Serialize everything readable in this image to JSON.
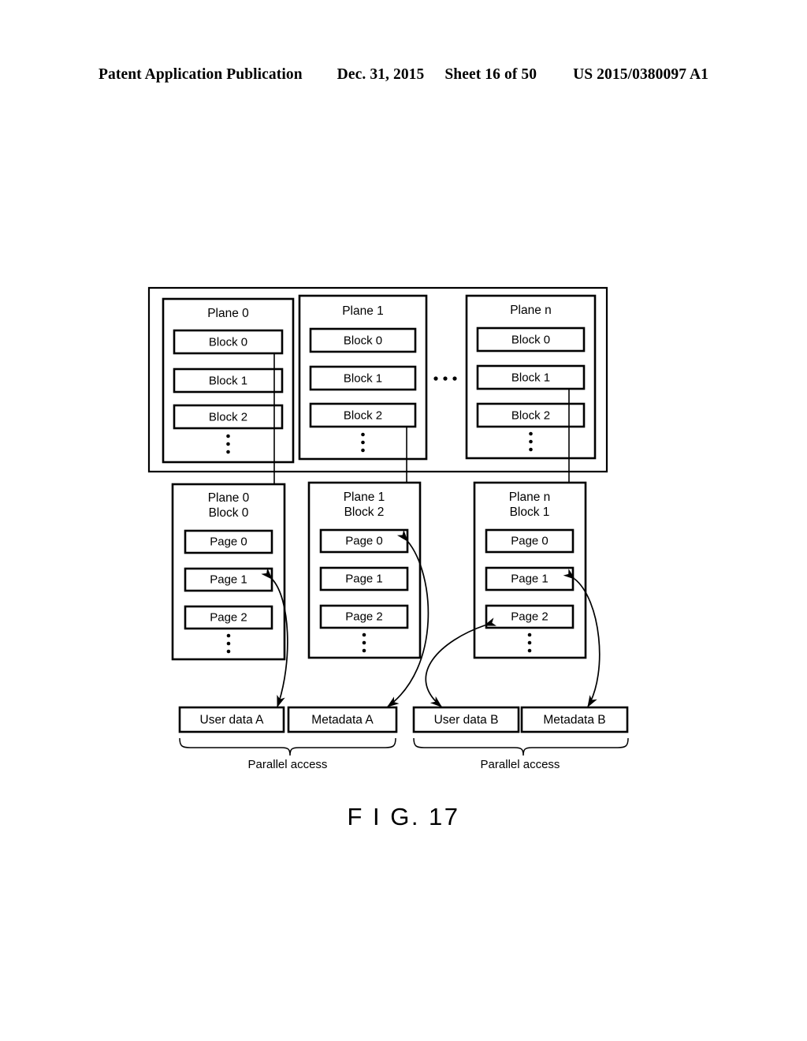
{
  "header": {
    "publication": "Patent Application Publication",
    "date": "Dec. 31, 2015",
    "sheet": "Sheet 16 of 50",
    "patent_number": "US 2015/0380097 A1"
  },
  "figure": {
    "caption": "F I G. 17",
    "ellipsis_horizontal": "• • •",
    "top_section": {
      "planes": [
        {
          "title": "Plane 0",
          "blocks": [
            "Block 0",
            "Block 1",
            "Block 2"
          ],
          "more": "vertical-ellipsis"
        },
        {
          "title": "Plane 1",
          "blocks": [
            "Block 0",
            "Block 1",
            "Block 2"
          ],
          "more": "vertical-ellipsis"
        },
        {
          "title": "Plane n",
          "blocks": [
            "Block 0",
            "Block 1",
            "Block 2"
          ],
          "more": "vertical-ellipsis"
        }
      ]
    },
    "middle_section": {
      "blocks": [
        {
          "title_line1": "Plane 0",
          "title_line2": "Block 0",
          "pages": [
            "Page 0",
            "Page 1",
            "Page 2"
          ],
          "more": "vertical-ellipsis"
        },
        {
          "title_line1": "Plane 1",
          "title_line2": "Block 2",
          "pages": [
            "Page 0",
            "Page 1",
            "Page 2"
          ],
          "more": "vertical-ellipsis"
        },
        {
          "title_line1": "Plane n",
          "title_line2": "Block 1",
          "pages": [
            "Page 0",
            "Page 1",
            "Page 2"
          ],
          "more": "vertical-ellipsis"
        }
      ]
    },
    "bottom_section": {
      "data_boxes": [
        "User data A",
        "Metadata A",
        "User data B",
        "Metadata B"
      ],
      "brace_labels": [
        "Parallel access",
        "Parallel access"
      ]
    }
  }
}
